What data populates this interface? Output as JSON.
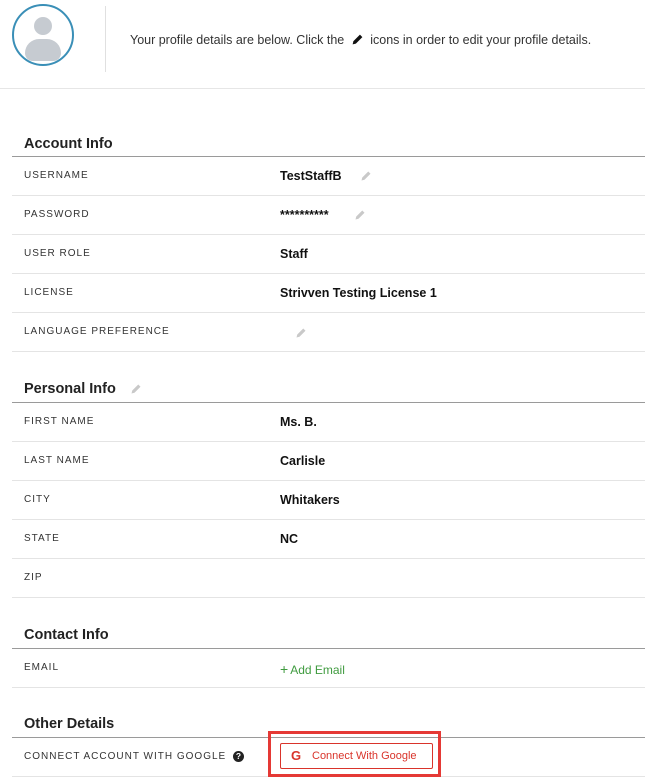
{
  "header": {
    "intro_before": "Your profile details are below. Click the",
    "intro_after": "icons in order to edit your profile details."
  },
  "account": {
    "title": "Account Info",
    "username_label": "USERNAME",
    "username_value": "TestStaffB",
    "password_label": "PASSWORD",
    "password_value": "**********",
    "role_label": "USER ROLE",
    "role_value": "Staff",
    "license_label": "LICENSE",
    "license_value": "Strivven Testing License 1",
    "language_label": "LANGUAGE PREFERENCE"
  },
  "personal": {
    "title": "Personal Info",
    "first_label": "FIRST NAME",
    "first_value": "Ms. B.",
    "last_label": "LAST NAME",
    "last_value": "Carlisle",
    "city_label": "CITY",
    "city_value": "Whitakers",
    "state_label": "STATE",
    "state_value": "NC",
    "zip_label": "ZIP"
  },
  "contact": {
    "title": "Contact Info",
    "email_label": "EMAIL",
    "add_email": "Add Email"
  },
  "other": {
    "title": "Other Details",
    "google_label": "CONNECT ACCOUNT WITH GOOGLE",
    "help_glyph": "?",
    "google_g": "G",
    "google_button": "Connect With Google"
  },
  "colors": {
    "avatar_ring": "#3a8fb7",
    "add_email": "#3f9b3f",
    "google_red": "#d9342b",
    "highlight": "#e53935"
  }
}
